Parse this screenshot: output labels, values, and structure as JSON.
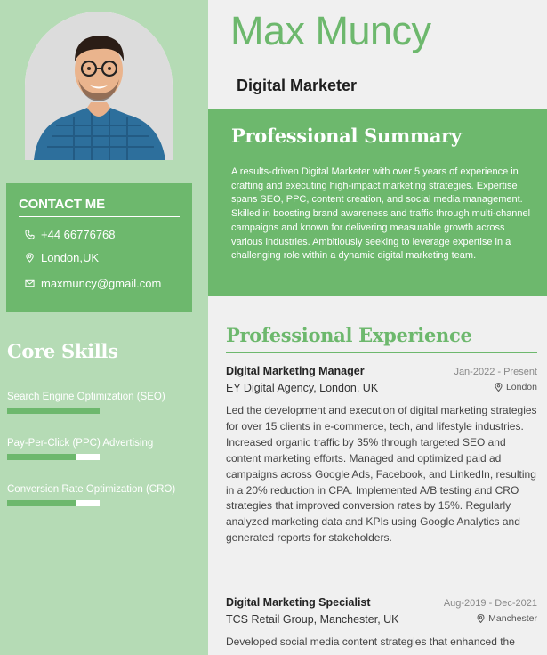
{
  "header": {
    "name": "Max Muncy",
    "job_title": "Digital Marketer"
  },
  "contact": {
    "title": "CONTACT ME",
    "phone": "+44 66776768",
    "location": "London,UK",
    "email": "maxmuncy@gmail.com"
  },
  "skills": {
    "title": "Core Skills",
    "items": [
      {
        "name": "Search Engine Optimization (SEO)",
        "level": 1.0
      },
      {
        "name": "Pay-Per-Click (PPC) Advertising",
        "level": 0.75
      },
      {
        "name": "Conversion Rate Optimization (CRO)",
        "level": 0.75
      }
    ]
  },
  "summary": {
    "heading": "Professional Summary",
    "text": "A results-driven Digital Marketer with over 5 years of experience in crafting and executing high-impact marketing strategies. Expertise spans SEO, PPC, content creation, and social media management. Skilled in boosting brand awareness and traffic through multi-channel campaigns and known for delivering measurable growth across various industries. Ambitiously seeking to leverage expertise in a challenging role within a dynamic digital marketing team."
  },
  "experience": {
    "heading": "Professional Experience",
    "items": [
      {
        "role": "Digital Marketing Manager",
        "dates": "Jan-2022 - Present",
        "company": "EY Digital Agency, London, UK",
        "location": "London",
        "description": "Led the development and execution of digital marketing strategies for over 15 clients in e-commerce, tech, and lifestyle industries. Increased organic traffic by 35% through targeted SEO and content marketing efforts. Managed and optimized paid ad campaigns across Google Ads, Facebook, and LinkedIn, resulting in a 20% reduction in CPA. Implemented A/B testing and CRO strategies that improved conversion rates by 15%. Regularly analyzed marketing data and KPIs using Google Analytics and generated reports for stakeholders."
      },
      {
        "role": "Digital Marketing Specialist",
        "dates": "Aug-2019 - Dec-2021",
        "company": "TCS Retail Group, Manchester, UK",
        "location": "Manchester",
        "description": "Developed social media content strategies that enhanced the"
      }
    ]
  },
  "colors": {
    "accent": "#6db86d",
    "sidebar": "#b5dbb5",
    "main_bg": "#f0f0f0"
  }
}
